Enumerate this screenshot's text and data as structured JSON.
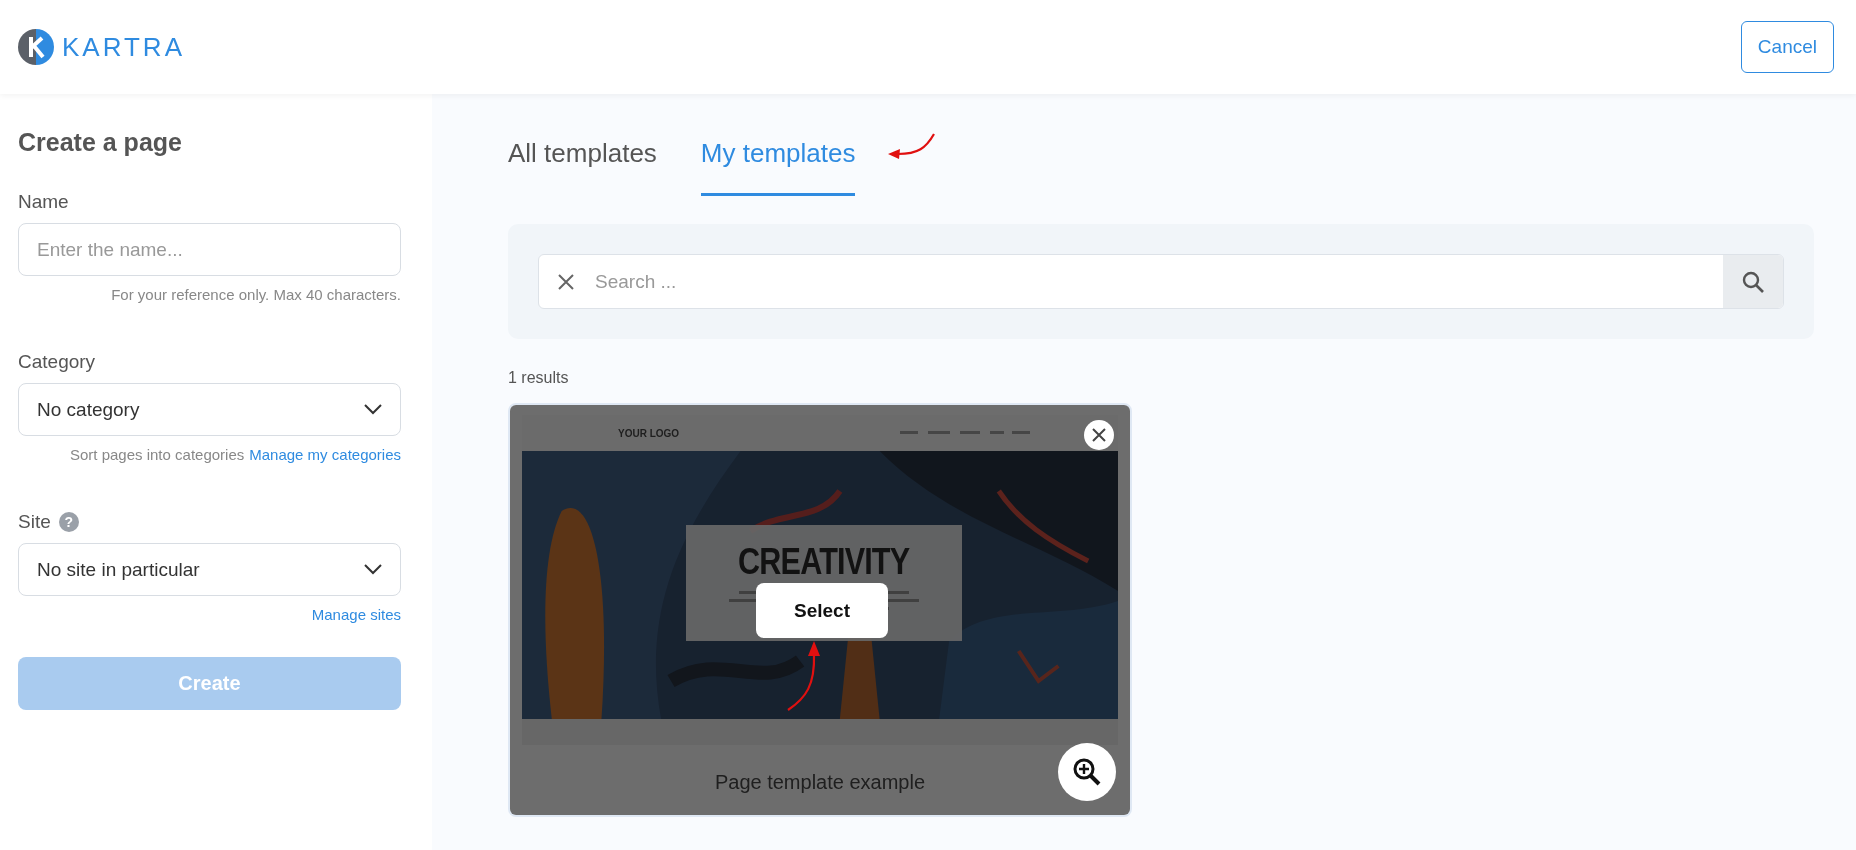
{
  "header": {
    "logo_text": "KARTRA",
    "cancel_label": "Cancel"
  },
  "form": {
    "title": "Create a page",
    "fields": [
      {
        "kind": "text",
        "label": "Name",
        "placeholder": "Enter the name...",
        "help": "For your reference only. Max 40 characters."
      },
      {
        "kind": "select",
        "label": "Category",
        "value": "No category",
        "help": "Sort pages into categories",
        "help_link": "Manage my categories"
      },
      {
        "kind": "select",
        "label": "Site",
        "hint_icon": "?",
        "value": "No site in particular",
        "help_link": "Manage sites"
      }
    ],
    "submit": {
      "label": "Create",
      "disabled": true
    }
  },
  "tabs": [
    {
      "label": "All templates",
      "selected": false
    },
    {
      "label": "My templates",
      "selected": true
    }
  ],
  "search": {
    "placeholder": "Search ..."
  },
  "results_count": "1 results",
  "templates": [
    {
      "name": "Page template example",
      "hovered": true,
      "select_label": "Select",
      "preview": {
        "logo": "YOUR LOGO",
        "heading": "CREATIVITY"
      }
    }
  ]
}
